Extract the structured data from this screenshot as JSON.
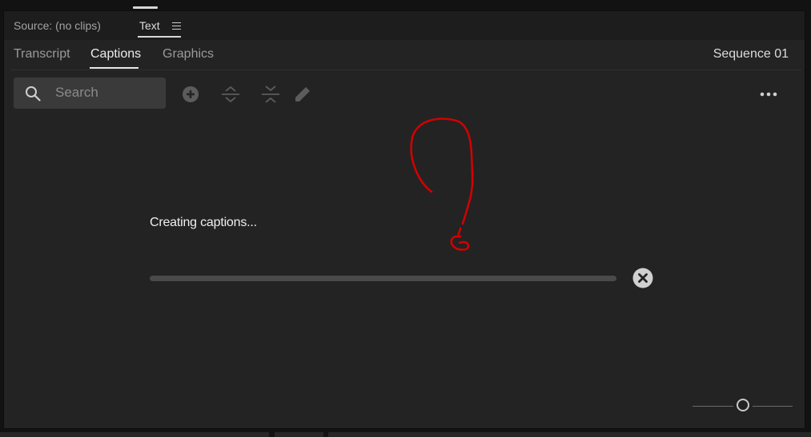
{
  "panel": {
    "source_tab": "Source: (no clips)",
    "text_tab": "Text",
    "menu_icon": "hamburger-menu-icon"
  },
  "subtabs": {
    "transcript": "Transcript",
    "captions": "Captions",
    "graphics": "Graphics",
    "active": "Captions"
  },
  "sequence_name": "Sequence 01",
  "toolbar": {
    "search_placeholder": "Search",
    "search_value": "",
    "icons": [
      "search-icon",
      "add-icon",
      "expand-icon",
      "collapse-icon",
      "pencil-icon",
      "more-icon"
    ]
  },
  "progress": {
    "status": "Creating captions...",
    "fraction": 0,
    "cancel_icon": "close-icon"
  },
  "annotation": {
    "color": "#d40000",
    "shape": "handwritten-question-mark"
  },
  "zoom": {
    "level": 0.5
  },
  "colors": {
    "panel_bg": "#232323",
    "header_bg": "#1d1d1d",
    "active_text": "#ececec",
    "inactive_text": "#9a9a9a"
  }
}
